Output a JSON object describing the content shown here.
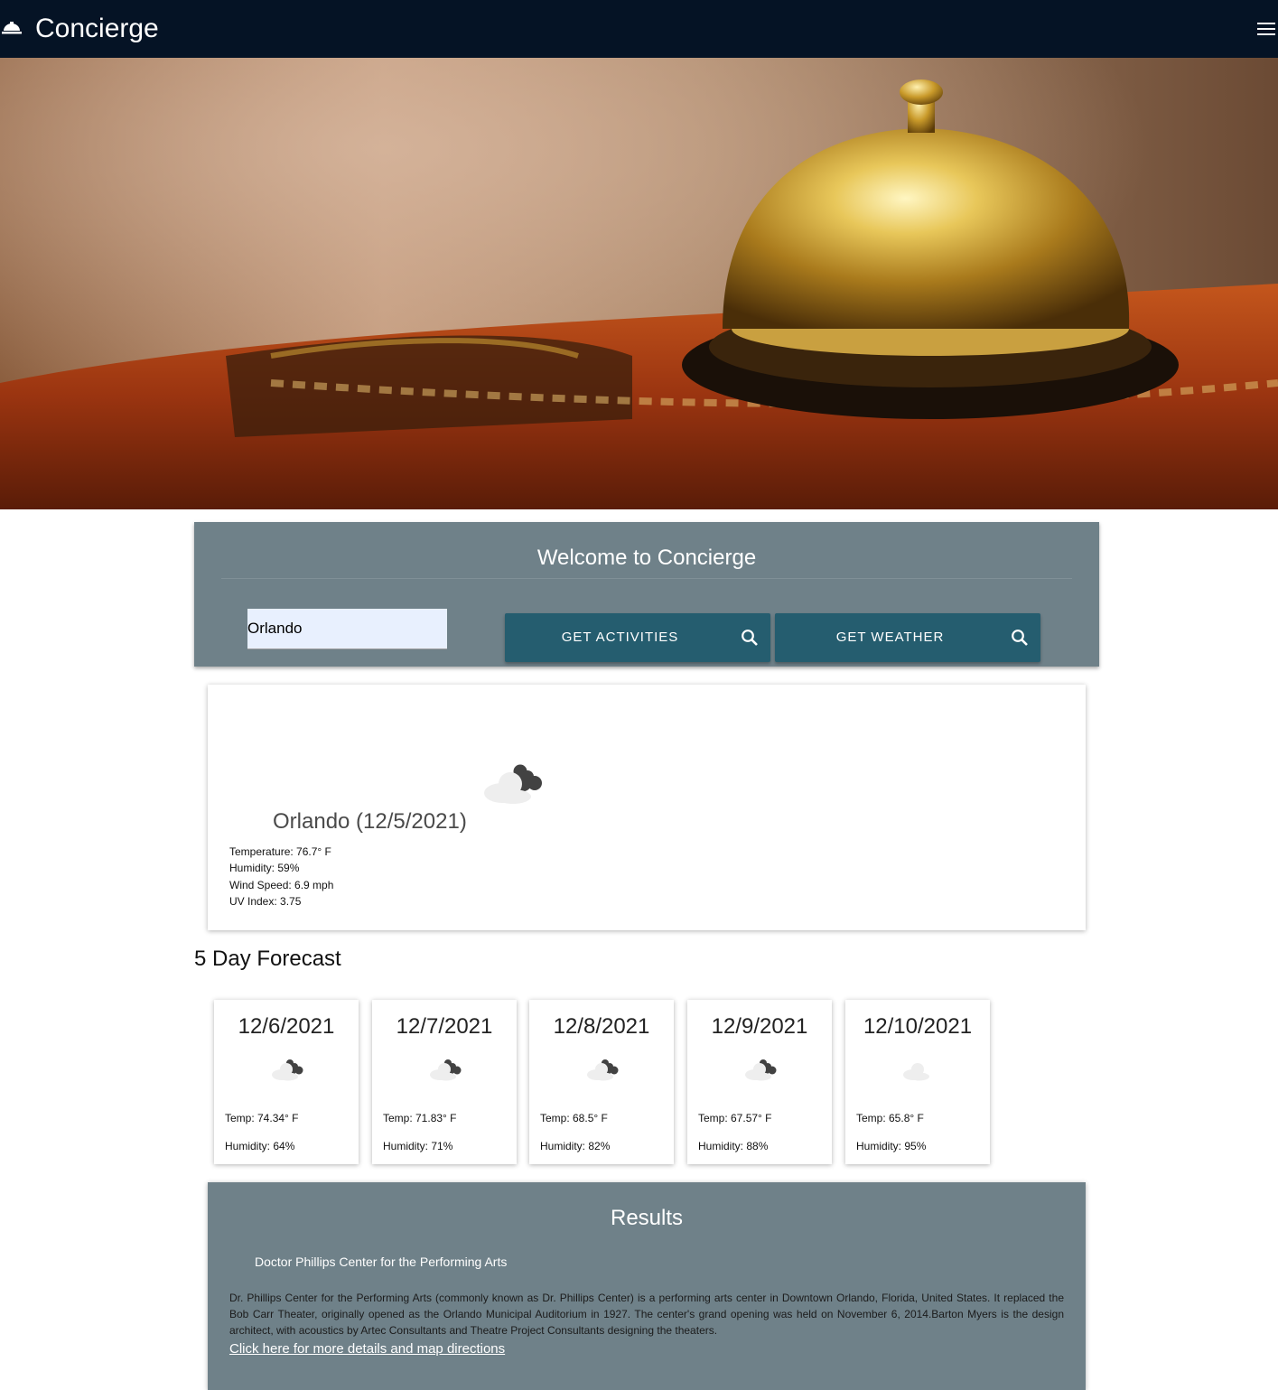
{
  "nav": {
    "title": "Concierge"
  },
  "welcome": {
    "title": "Welcome to Concierge",
    "city_value": "Orlando",
    "activities_label": "GET ACTIVITIES",
    "weather_label": "GET WEATHER"
  },
  "current": {
    "heading": "Orlando (12/5/2021)",
    "temperature": "Temperature: 76.7° F",
    "humidity": "Humidity: 59%",
    "wind": "Wind Speed: 6.9 mph",
    "uv": "UV Index: 3.75",
    "icon": "broken-clouds-icon"
  },
  "forecast": {
    "heading": "5 Day Forecast",
    "days": [
      {
        "date": "12/6/2021",
        "temp": "Temp: 74.34° F",
        "humidity": "Humidity: 64%",
        "icon": "broken-clouds-icon"
      },
      {
        "date": "12/7/2021",
        "temp": "Temp: 71.83° F",
        "humidity": "Humidity: 71%",
        "icon": "broken-clouds-icon"
      },
      {
        "date": "12/8/2021",
        "temp": "Temp: 68.5° F",
        "humidity": "Humidity: 82%",
        "icon": "broken-clouds-icon"
      },
      {
        "date": "12/9/2021",
        "temp": "Temp: 67.57° F",
        "humidity": "Humidity: 88%",
        "icon": "broken-clouds-icon"
      },
      {
        "date": "12/10/2021",
        "temp": "Temp: 65.8° F",
        "humidity": "Humidity: 95%",
        "icon": "cloud-icon"
      }
    ]
  },
  "results": {
    "title": "Results",
    "name": "Doctor Phillips Center for the Performing Arts",
    "description": "Dr. Phillips Center for the Performing Arts (commonly known as Dr. Phillips Center) is a performing arts center in Downtown Orlando, Florida, United States. It replaced the Bob Carr Theater, originally opened as the Orlando Municipal Auditorium in 1927. The center's grand opening was held on November 6, 2014.Barton Myers is the design architect, with acoustics by Artec Consultants and Theatre Project Consultants designing the theaters.",
    "link": "Click here for more details and map directions"
  },
  "colors": {
    "navbar": "#051325",
    "panel": "#6f8189",
    "button": "#255d6f",
    "input": "#e8f0fe"
  }
}
